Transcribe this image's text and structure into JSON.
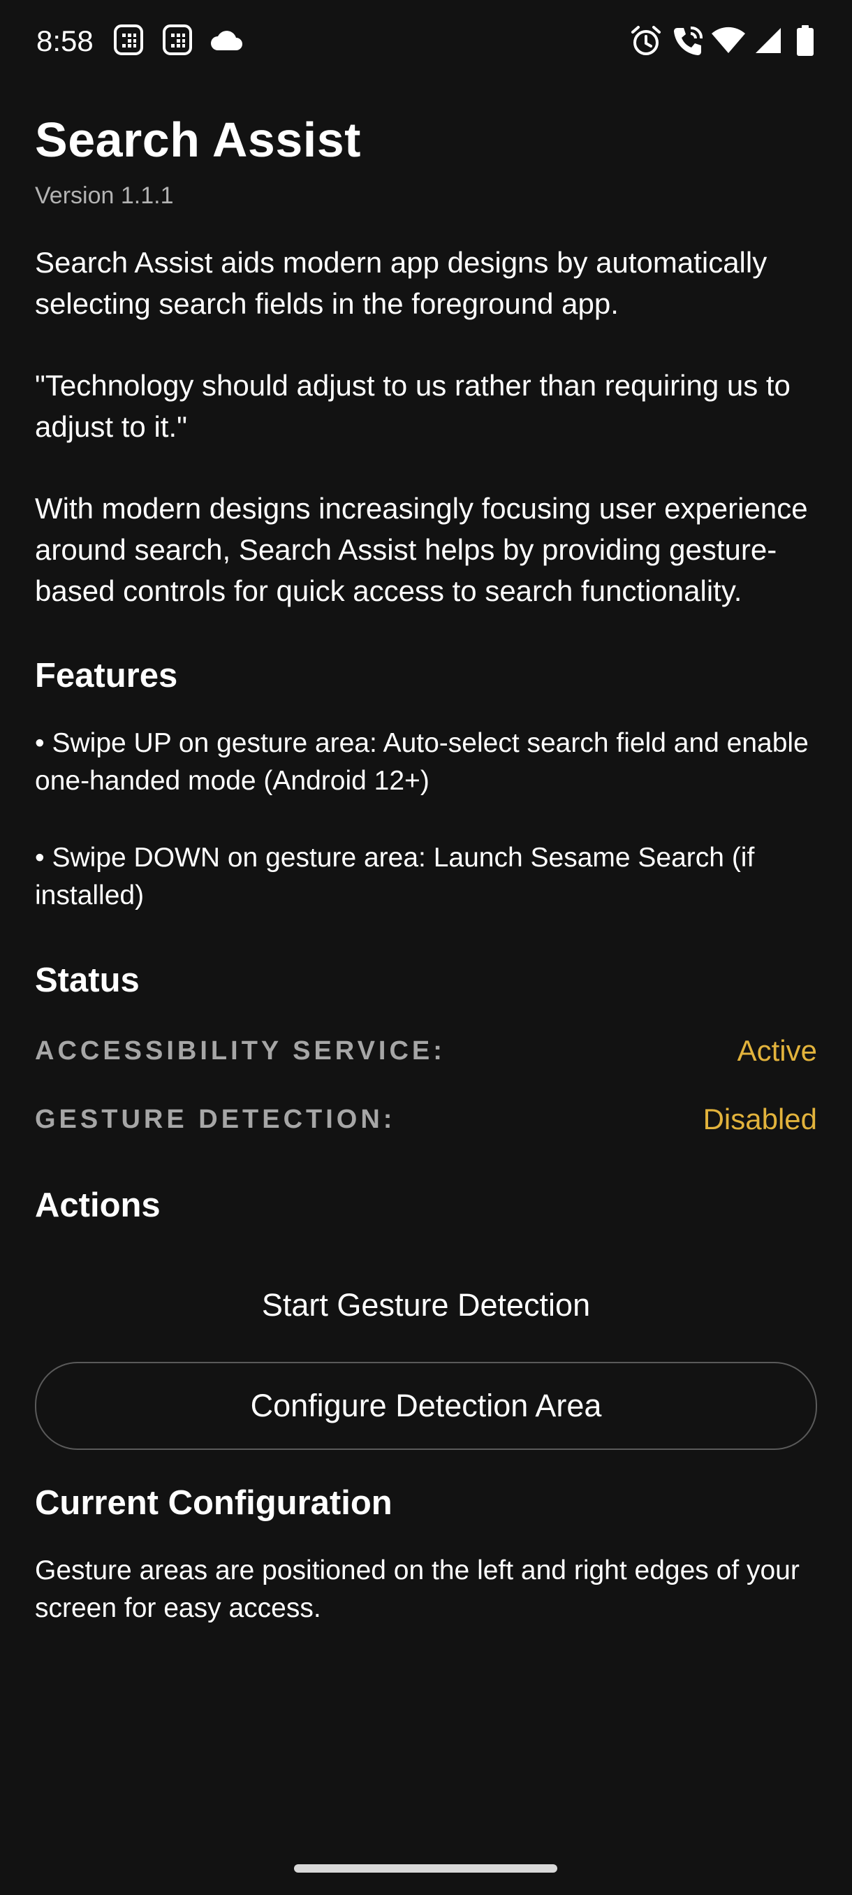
{
  "status_bar": {
    "time": "8:58",
    "left_icons": [
      "notification-grid-icon",
      "notification-grid-icon",
      "cloud-icon"
    ],
    "right_icons": [
      "alarm-icon",
      "wifi-calling-icon",
      "wifi-icon",
      "signal-icon",
      "battery-icon"
    ]
  },
  "app": {
    "title": "Search Assist",
    "version": "Version 1.1.1"
  },
  "intro": {
    "p1": "Search Assist aids modern app designs by automatically selecting search fields in the foreground app.",
    "p2": "\"Technology should adjust to us rather than requiring us to adjust to it.\"",
    "p3": "With modern designs increasingly focusing user experience around search, Search Assist helps by providing gesture-based controls for quick access to search functionality."
  },
  "features": {
    "title": "Features",
    "items": [
      "• Swipe UP on gesture area: Auto-select search field and enable one-handed mode (Android 12+)",
      "• Swipe DOWN on gesture area: Launch Sesame Search (if installed)"
    ]
  },
  "status": {
    "title": "Status",
    "rows": [
      {
        "label": "ACCESSIBILITY SERVICE:",
        "value": "Active"
      },
      {
        "label": "GESTURE DETECTION:",
        "value": "Disabled"
      }
    ],
    "value_color": "#e2b33c"
  },
  "actions": {
    "title": "Actions",
    "start_label": "Start Gesture Detection",
    "configure_label": "Configure Detection Area"
  },
  "configuration": {
    "title": "Current Configuration",
    "text": "Gesture areas are positioned on the left and right edges of your screen for easy access."
  }
}
